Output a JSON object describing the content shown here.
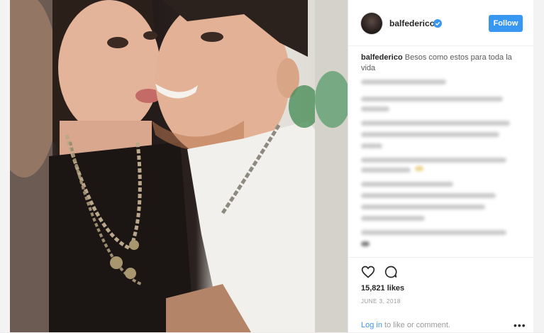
{
  "post": {
    "username": "balfederico",
    "follow_label": "Follow",
    "caption_user": "balfederico",
    "caption_text": "Besos como estos para toda la vida",
    "likes": "15,821 likes",
    "date": "JUNE 3, 2018",
    "login_link": "Log in",
    "login_rest": "to like or comment."
  },
  "colors": {
    "accent": "#3897f0",
    "text": "#262626",
    "muted": "#999999"
  },
  "icons": {
    "verified": "verified-badge-icon",
    "like": "heart-icon",
    "comment": "comment-icon",
    "more": "more-options-icon"
  }
}
